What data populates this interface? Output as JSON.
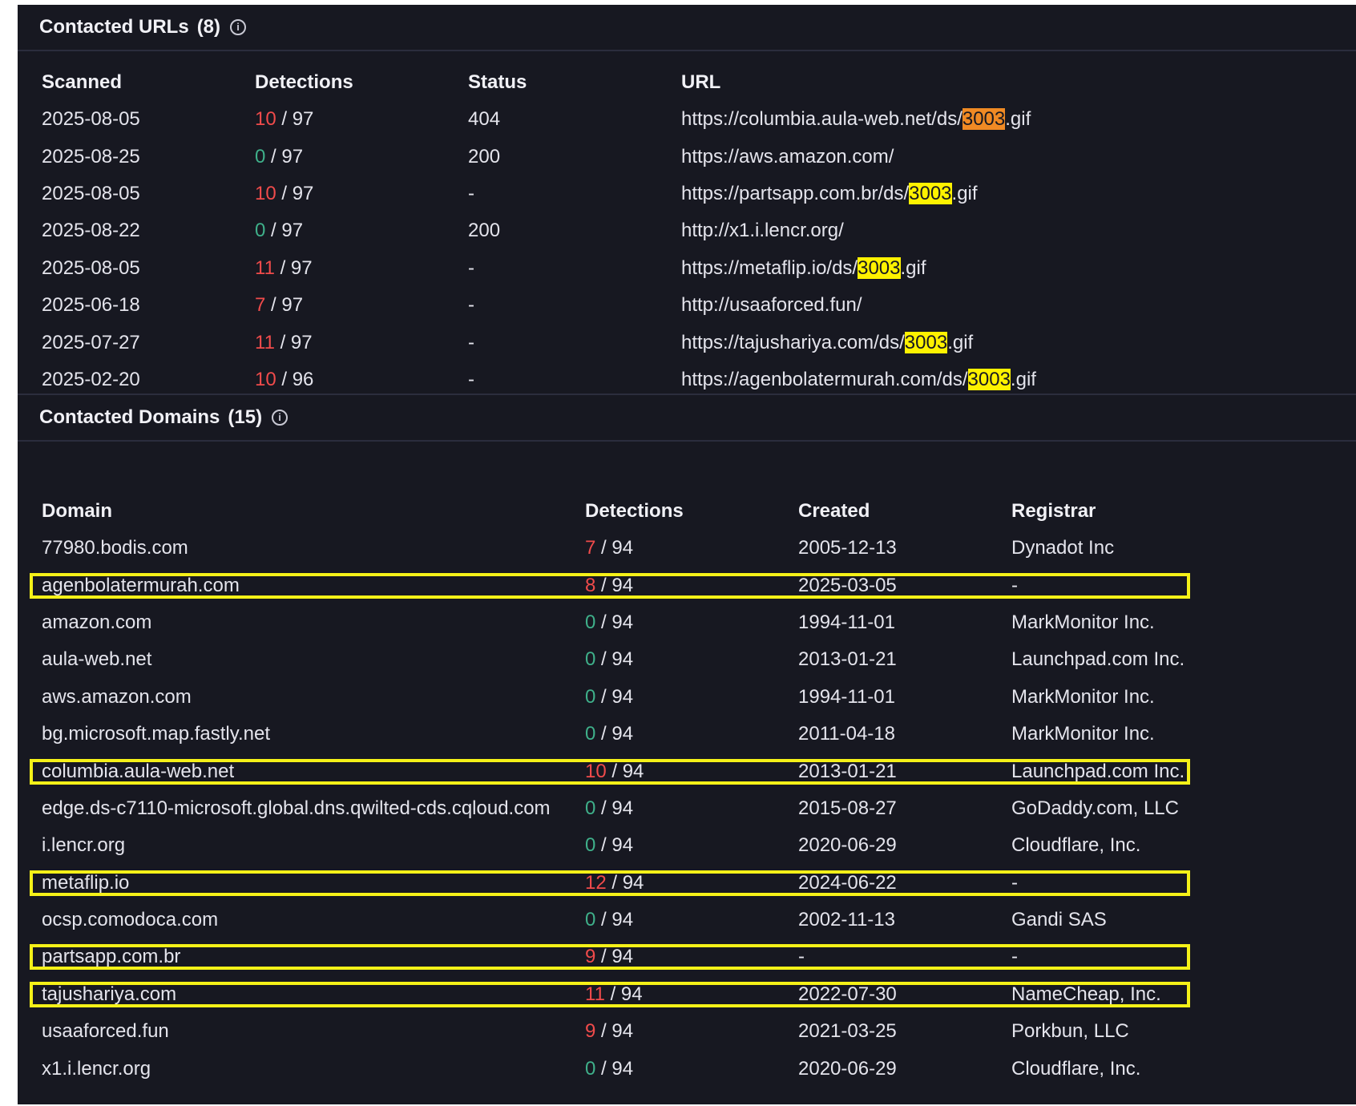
{
  "urls_section": {
    "title": "Contacted URLs",
    "count": "(8)",
    "info_icon": "info-icon",
    "columns": [
      "Scanned",
      "Detections",
      "Status",
      "URL"
    ],
    "rows": [
      {
        "scanned": "2025-08-05",
        "det": "10",
        "total": "/ 97",
        "status": "404",
        "url_pre": "https://columbia.aula-web.net/ds/",
        "url_mark": "3003",
        "url_post": ".gif",
        "mark_color": "orange",
        "det_state": "bad"
      },
      {
        "scanned": "2025-08-25",
        "det": "0",
        "total": "/ 97",
        "status": "200",
        "url_pre": "https://aws.amazon.com/",
        "url_mark": "",
        "url_post": "",
        "mark_color": "",
        "det_state": "ok"
      },
      {
        "scanned": "2025-08-05",
        "det": "10",
        "total": "/ 97",
        "status": "-",
        "url_pre": "https://partsapp.com.br/ds/",
        "url_mark": "3003",
        "url_post": ".gif",
        "mark_color": "yellow",
        "det_state": "bad"
      },
      {
        "scanned": "2025-08-22",
        "det": "0",
        "total": "/ 97",
        "status": "200",
        "url_pre": "http://x1.i.lencr.org/",
        "url_mark": "",
        "url_post": "",
        "mark_color": "",
        "det_state": "ok"
      },
      {
        "scanned": "2025-08-05",
        "det": "11",
        "total": "/ 97",
        "status": "-",
        "url_pre": "https://metaflip.io/ds/",
        "url_mark": "3003",
        "url_post": ".gif",
        "mark_color": "yellow",
        "det_state": "bad"
      },
      {
        "scanned": "2025-06-18",
        "det": "7",
        "total": "/ 97",
        "status": "-",
        "url_pre": "http://usaaforced.fun/",
        "url_mark": "",
        "url_post": "",
        "mark_color": "",
        "det_state": "bad"
      },
      {
        "scanned": "2025-07-27",
        "det": "11",
        "total": "/ 97",
        "status": "-",
        "url_pre": "https://tajushariya.com/ds/",
        "url_mark": "3003",
        "url_post": ".gif",
        "mark_color": "yellow",
        "det_state": "bad"
      },
      {
        "scanned": "2025-02-20",
        "det": "10",
        "total": "/ 96",
        "status": "-",
        "url_pre": "https://agenbolatermurah.com/ds/",
        "url_mark": "3003",
        "url_post": ".gif",
        "mark_color": "yellow",
        "det_state": "bad"
      }
    ]
  },
  "domains_section": {
    "title": "Contacted Domains",
    "count": "(15)",
    "info_icon": "info-icon",
    "columns": [
      "Domain",
      "Detections",
      "Created",
      "Registrar"
    ],
    "rows": [
      {
        "domain": "77980.bodis.com",
        "det": "7",
        "total": "/ 94",
        "created": "2005-12-13",
        "registrar": "Dynadot Inc",
        "det_state": "bad",
        "boxed": false
      },
      {
        "domain": "agenbolatermurah.com",
        "det": "8",
        "total": "/ 94",
        "created": "2025-03-05",
        "registrar": "-",
        "det_state": "bad",
        "boxed": true
      },
      {
        "domain": "amazon.com",
        "det": "0",
        "total": "/ 94",
        "created": "1994-11-01",
        "registrar": "MarkMonitor Inc.",
        "det_state": "ok",
        "boxed": false
      },
      {
        "domain": "aula-web.net",
        "det": "0",
        "total": "/ 94",
        "created": "2013-01-21",
        "registrar": "Launchpad.com Inc.",
        "det_state": "ok",
        "boxed": false
      },
      {
        "domain": "aws.amazon.com",
        "det": "0",
        "total": "/ 94",
        "created": "1994-11-01",
        "registrar": "MarkMonitor Inc.",
        "det_state": "ok",
        "boxed": false
      },
      {
        "domain": "bg.microsoft.map.fastly.net",
        "det": "0",
        "total": "/ 94",
        "created": "2011-04-18",
        "registrar": "MarkMonitor Inc.",
        "det_state": "ok",
        "boxed": false
      },
      {
        "domain": "columbia.aula-web.net",
        "det": "10",
        "total": "/ 94",
        "created": "2013-01-21",
        "registrar": "Launchpad.com Inc.",
        "det_state": "bad",
        "boxed": true
      },
      {
        "domain": "edge.ds-c7110-microsoft.global.dns.qwilted-cds.cqloud.com",
        "det": "0",
        "total": "/ 94",
        "created": "2015-08-27",
        "registrar": "GoDaddy.com, LLC",
        "det_state": "ok",
        "boxed": false
      },
      {
        "domain": "i.lencr.org",
        "det": "0",
        "total": "/ 94",
        "created": "2020-06-29",
        "registrar": "Cloudflare, Inc.",
        "det_state": "ok",
        "boxed": false
      },
      {
        "domain": "metaflip.io",
        "det": "12",
        "total": "/ 94",
        "created": "2024-06-22",
        "registrar": "-",
        "det_state": "bad",
        "boxed": true
      },
      {
        "domain": "ocsp.comodoca.com",
        "det": "0",
        "total": "/ 94",
        "created": "2002-11-13",
        "registrar": "Gandi SAS",
        "det_state": "ok",
        "boxed": false
      },
      {
        "domain": "partsapp.com.br",
        "det": "9",
        "total": "/ 94",
        "created": "-",
        "registrar": "-",
        "det_state": "bad",
        "boxed": true
      },
      {
        "domain": "tajushariya.com",
        "det": "11",
        "total": "/ 94",
        "created": "2022-07-30",
        "registrar": "NameCheap, Inc.",
        "det_state": "bad",
        "boxed": true
      },
      {
        "domain": "usaaforced.fun",
        "det": "9",
        "total": "/ 94",
        "created": "2021-03-25",
        "registrar": "Porkbun, LLC",
        "det_state": "bad",
        "boxed": false
      },
      {
        "domain": "x1.i.lencr.org",
        "det": "0",
        "total": "/ 94",
        "created": "2020-06-29",
        "registrar": "Cloudflare, Inc.",
        "det_state": "ok",
        "boxed": false
      }
    ]
  },
  "colors": {
    "panel_bg": "#171821",
    "detection_bad": "#f04b4b",
    "detection_ok": "#3fb08a",
    "highlight_yellow": "#fff200",
    "highlight_orange": "#f08a24",
    "box_outline": "#f5f118"
  }
}
